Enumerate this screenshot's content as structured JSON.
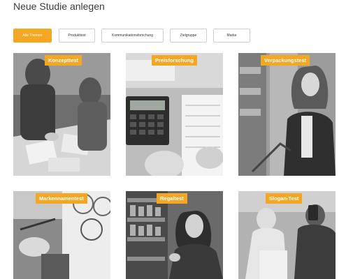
{
  "page": {
    "title": "Neue Studie anlegen"
  },
  "filters": [
    {
      "label": "Alle Themen",
      "active": true
    },
    {
      "label": "Produkttest",
      "active": false
    },
    {
      "label": "Kommunikationsforschung",
      "active": false
    },
    {
      "label": "Zielgruppe",
      "active": false
    },
    {
      "label": "Marke",
      "active": false
    }
  ],
  "studies": [
    {
      "label": "Konzepttest"
    },
    {
      "label": "Preisforschung"
    },
    {
      "label": "Verpackungstest"
    },
    {
      "label": "Markennamentest"
    },
    {
      "label": "Regaltest"
    },
    {
      "label": "Slogan-Test"
    }
  ],
  "colors": {
    "accent": "#f5a623"
  }
}
